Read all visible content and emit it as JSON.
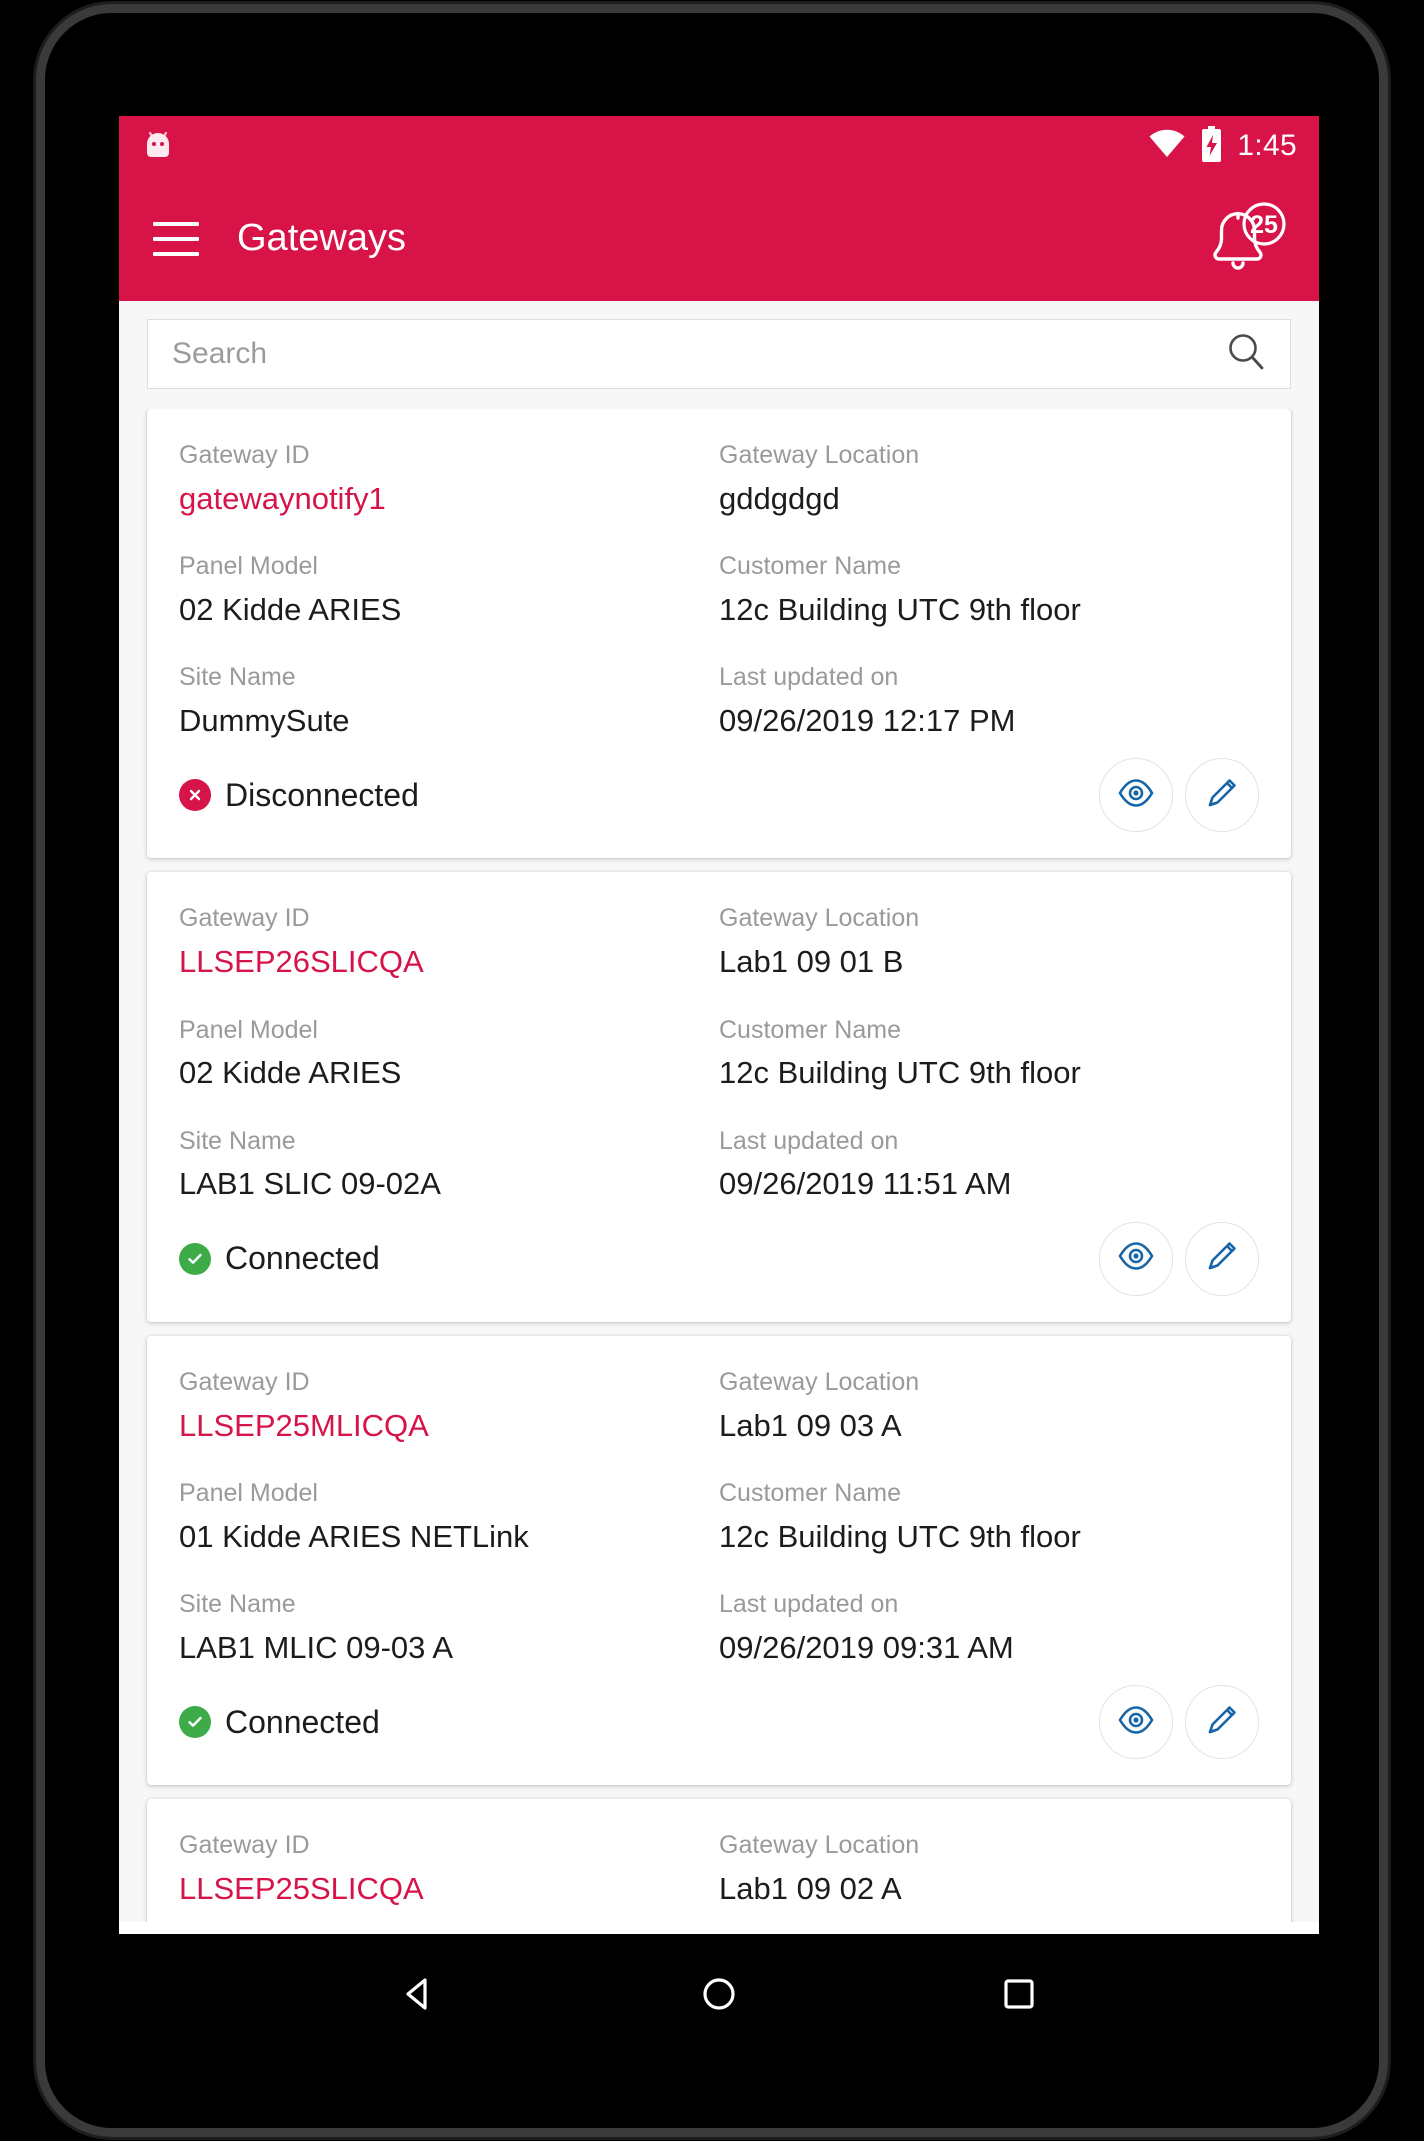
{
  "status_bar": {
    "notification_icon": "android-bugdroid-icon",
    "wifi_icon": "wifi-icon",
    "battery_icon": "battery-charging-icon",
    "clock": "1:45"
  },
  "app_bar": {
    "menu_icon": "hamburger-menu-icon",
    "title": "Gateways",
    "notification_icon": "bell-icon",
    "notification_count": "25"
  },
  "search": {
    "placeholder": "Search",
    "value": "",
    "icon": "search-icon"
  },
  "labels": {
    "gateway_id": "Gateway ID",
    "gateway_location": "Gateway Location",
    "panel_model": "Panel Model",
    "customer_name": "Customer Name",
    "site_name": "Site Name",
    "last_updated_on": "Last updated on"
  },
  "colors": {
    "brand": "#d81348",
    "accent": "#d6144a",
    "connected": "#3eab49",
    "disconnected": "#d6144a",
    "action_icon": "#1565a8"
  },
  "actions": {
    "view_icon": "eye-icon",
    "edit_icon": "pencil-icon"
  },
  "gateways": [
    {
      "gateway_id": "gatewaynotify1",
      "gateway_location": "gddgdgd",
      "panel_model": "02 Kidde ARIES",
      "customer_name": "12c Building UTC 9th floor",
      "site_name": "DummySute",
      "last_updated_on": "09/26/2019 12:17 PM",
      "status": "Disconnected",
      "status_state": "disconnected"
    },
    {
      "gateway_id": "LLSEP26SLICQA",
      "gateway_location": "Lab1 09 01 B",
      "panel_model": "02 Kidde ARIES",
      "customer_name": "12c Building UTC 9th floor",
      "site_name": "LAB1 SLIC 09-02A",
      "last_updated_on": "09/26/2019 11:51 AM",
      "status": "Connected",
      "status_state": "connected"
    },
    {
      "gateway_id": "LLSEP25MLICQA",
      "gateway_location": "Lab1 09 03 A",
      "panel_model": "01 Kidde ARIES NETLink",
      "customer_name": "12c Building UTC 9th floor",
      "site_name": "LAB1 MLIC 09-03 A",
      "last_updated_on": "09/26/2019 09:31 AM",
      "status": "Connected",
      "status_state": "connected"
    },
    {
      "gateway_id": "LLSEP25SLICQA",
      "gateway_location": "Lab1 09 02 A",
      "panel_model": "",
      "customer_name": "",
      "site_name": "",
      "last_updated_on": "",
      "status": "",
      "status_state": "partial"
    }
  ],
  "nav_bar": {
    "back_icon": "back-triangle-icon",
    "home_icon": "home-circle-icon",
    "recents_icon": "recents-square-icon"
  }
}
